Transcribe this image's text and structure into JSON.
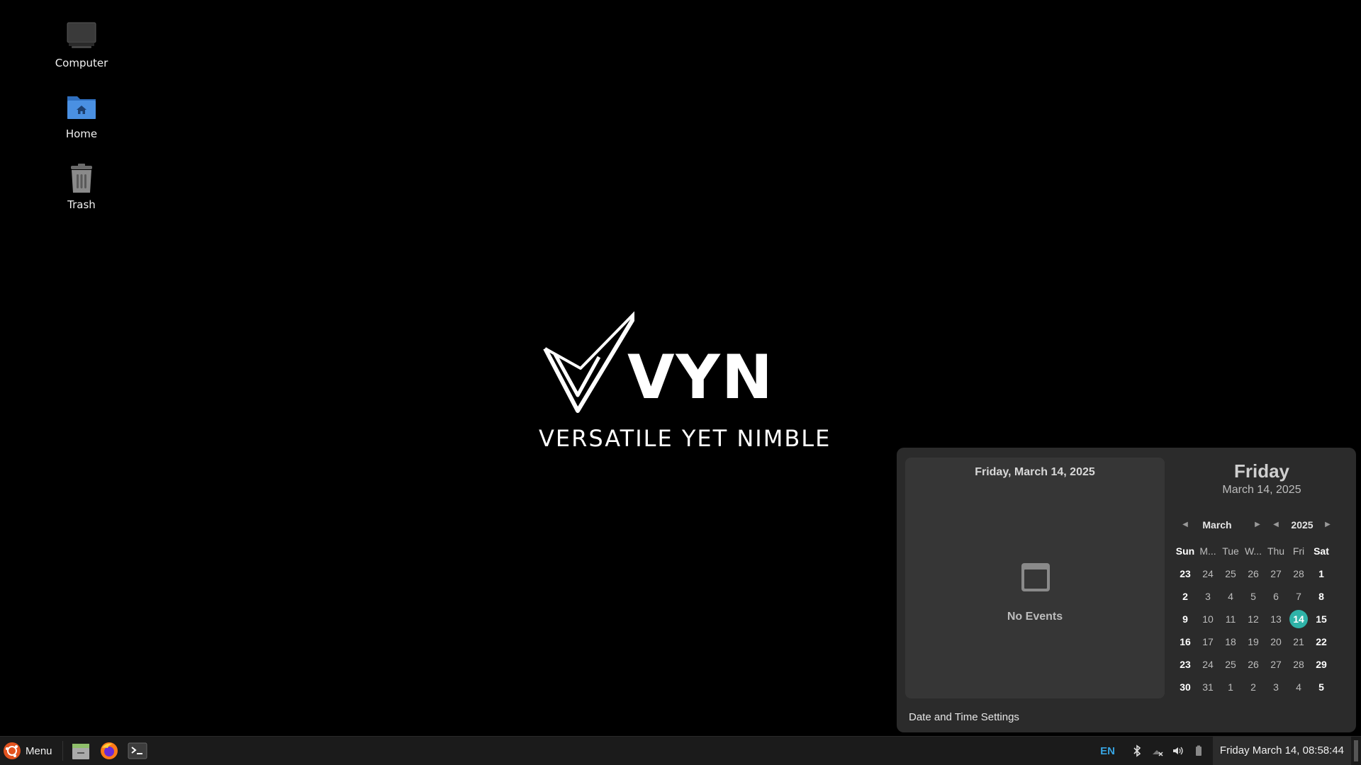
{
  "desktop": {
    "icons": [
      {
        "label": "Computer",
        "icon": "computer-icon"
      },
      {
        "label": "Home",
        "icon": "home-folder-icon"
      },
      {
        "label": "Trash",
        "icon": "trash-icon"
      }
    ]
  },
  "wallpaper": {
    "wordmark": "VYN",
    "tagline": "VERSATILE YET NIMBLE"
  },
  "calendar": {
    "events_date": "Friday, March 14, 2025",
    "no_events": "No Events",
    "settings_link": "Date and Time Settings",
    "weekday": "Friday",
    "full_date": "March 14, 2025",
    "month": "March",
    "year": "2025",
    "day_headers": [
      "Sun",
      "M...",
      "Tue",
      "W...",
      "Thu",
      "Fri",
      "Sat"
    ],
    "weeks": [
      [
        "23",
        "24",
        "25",
        "26",
        "27",
        "28",
        "1"
      ],
      [
        "2",
        "3",
        "4",
        "5",
        "6",
        "7",
        "8"
      ],
      [
        "9",
        "10",
        "11",
        "12",
        "13",
        "14",
        "15"
      ],
      [
        "16",
        "17",
        "18",
        "19",
        "20",
        "21",
        "22"
      ],
      [
        "23",
        "24",
        "25",
        "26",
        "27",
        "28",
        "29"
      ],
      [
        "30",
        "31",
        "1",
        "2",
        "3",
        "4",
        "5"
      ]
    ],
    "today": "14",
    "accent_color": "#2fb3a8"
  },
  "taskbar": {
    "menu_label": "Menu",
    "launchers": [
      "file-manager-icon",
      "firefox-icon",
      "terminal-icon"
    ],
    "keyboard_layout": "EN",
    "tray_icons": [
      "bluetooth-icon",
      "network-disconnected-icon",
      "volume-icon",
      "battery-icon"
    ],
    "clock": "Friday March 14, 08:58:44"
  }
}
